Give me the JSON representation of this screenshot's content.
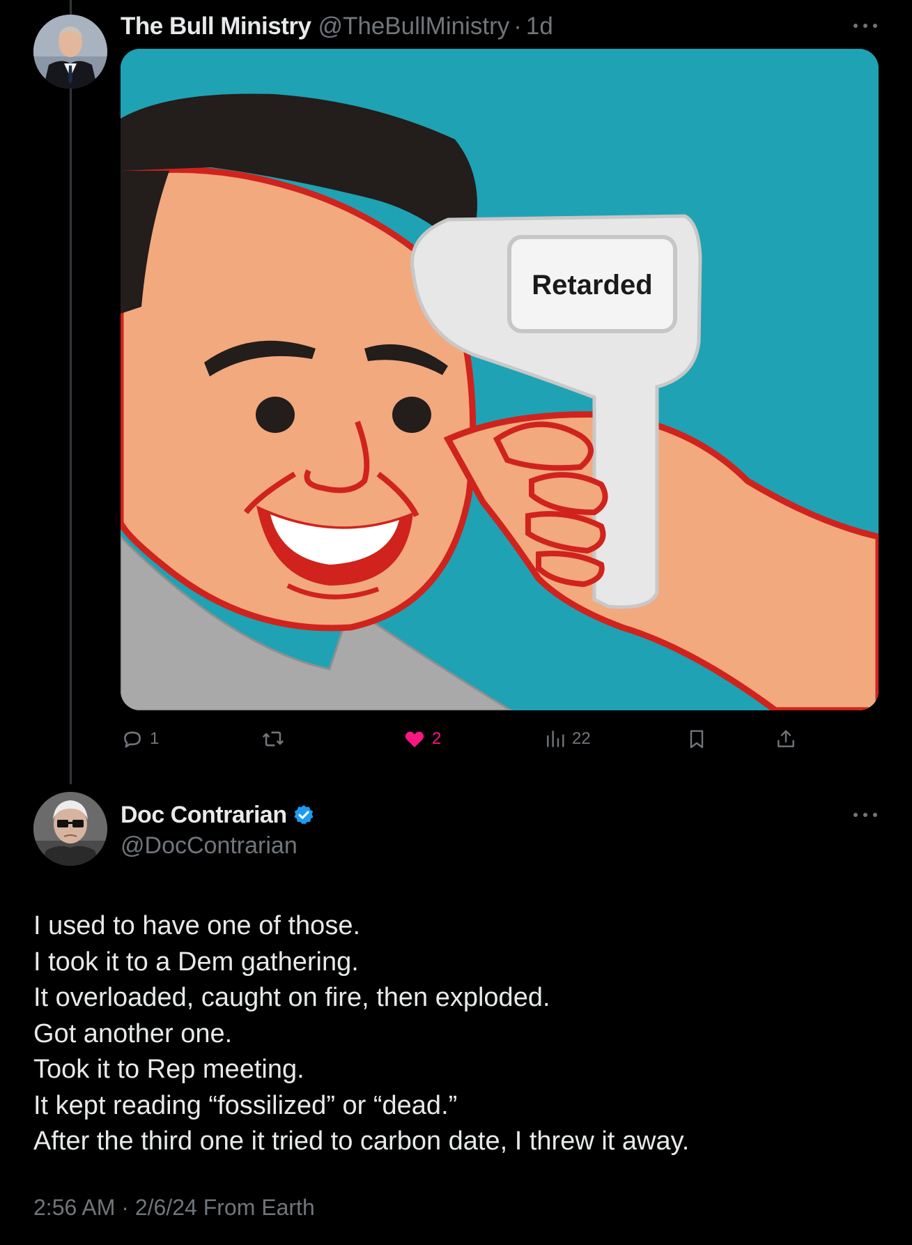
{
  "tweet1": {
    "display_name": "The Bull Ministry",
    "handle": "@TheBullMinistry",
    "separator": "·",
    "time": "1d",
    "image_text": "Retarded",
    "actions": {
      "replies": "1",
      "likes": "2",
      "views": "22"
    },
    "icons": [
      "reply-icon",
      "retweet-icon",
      "heart-icon",
      "views-icon",
      "bookmark-icon",
      "share-icon",
      "more-icon"
    ]
  },
  "tweet2": {
    "display_name": "Doc Contrarian",
    "handle": "@DocContrarian",
    "verified": true,
    "lines": [
      "I used to have one of those.",
      "I took it to a Dem gathering.",
      "It overloaded, caught on fire, then exploded.",
      "Got another one.",
      "Took it to Rep meeting.",
      "It kept reading “fossilized” or “dead.”",
      "After the third one it tried to carbon date, I threw it away."
    ],
    "meta": "2:56 AM · 2/6/24 From Earth"
  },
  "colors": {
    "background": "#000000",
    "text_primary": "#e7e9ea",
    "text_secondary": "#71767b",
    "like_pink": "#f91880",
    "verified_blue": "#1d9bf0",
    "image_teal": "#1fa2b4"
  }
}
